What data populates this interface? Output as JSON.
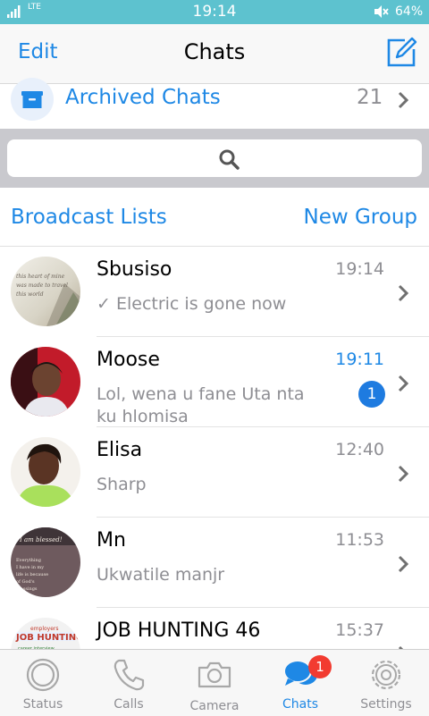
{
  "status_bar": {
    "network": "LTE",
    "time": "19:14",
    "battery": "64%"
  },
  "nav": {
    "edit": "Edit",
    "title": "Chats",
    "compose_icon": "compose-icon"
  },
  "archived": {
    "label": "Archived Chats",
    "count": "21"
  },
  "search": {
    "placeholder": ""
  },
  "links": {
    "broadcast": "Broadcast Lists",
    "new_group": "New Group"
  },
  "chats": [
    {
      "name": "Sbusiso",
      "time": "19:14",
      "preview": "Electric is gone now",
      "sent_check": true,
      "unread": 0,
      "avatar_text": "this heart of mine was made to travel this world"
    },
    {
      "name": "Moose",
      "time": "19:11",
      "preview": "Lol, wena u fane Uta nta ku hlomisa",
      "sent_check": false,
      "unread": "1"
    },
    {
      "name": "Elisa",
      "time": "12:40",
      "preview": "Sharp",
      "sent_check": false,
      "unread": 0
    },
    {
      "name": "Mn",
      "time": "11:53",
      "preview": "Ukwatile manjr",
      "sent_check": false,
      "unread": 0,
      "avatar_text": "I am blessed! Everything I have in my life is because of God's blessings"
    },
    {
      "name": "JOB HUNTING 46",
      "time": "15:37",
      "preview": "",
      "sent_check": false,
      "unread": 0,
      "avatar_text": "JOB HUNTING"
    }
  ],
  "tabs": [
    {
      "label": "Status"
    },
    {
      "label": "Calls"
    },
    {
      "label": "Camera"
    },
    {
      "label": "Chats",
      "badge": "1"
    },
    {
      "label": "Settings"
    }
  ],
  "colors": {
    "accent": "#1e88e5",
    "status_bar": "#5dc2cf",
    "badge_red": "#f23b30"
  }
}
